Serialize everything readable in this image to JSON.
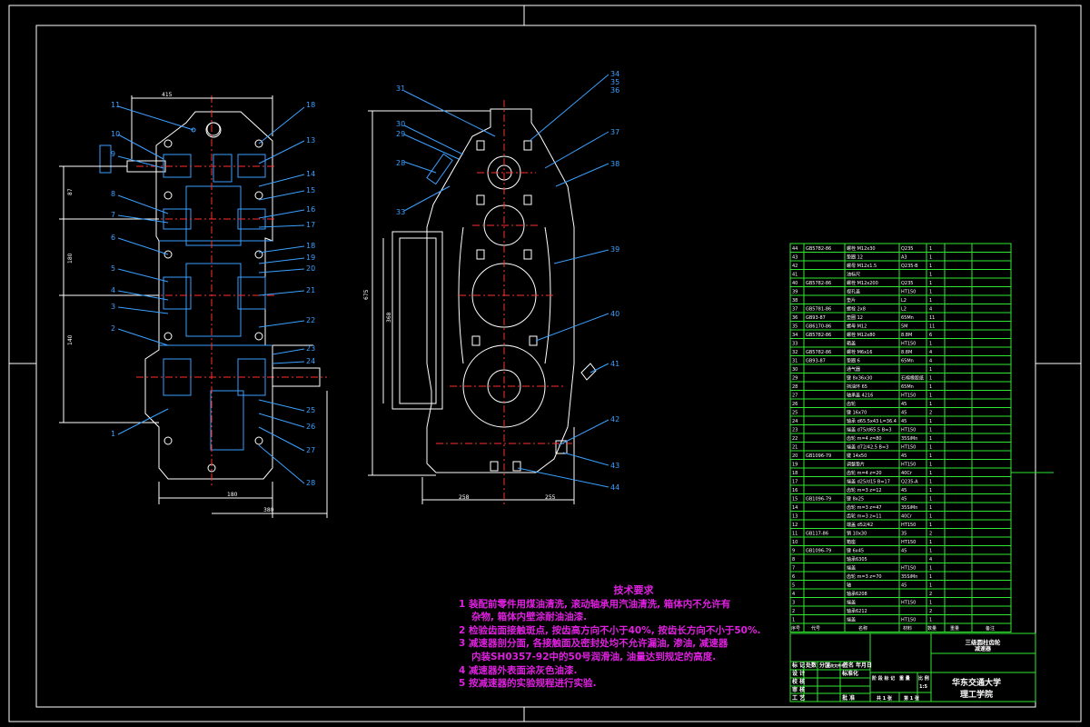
{
  "drawing": {
    "front_view_labels": [
      "11",
      "10",
      "9",
      "8",
      "7",
      "6",
      "5",
      "4",
      "3",
      "2",
      "1",
      "18",
      "13",
      "14",
      "15",
      "16",
      "17",
      "18",
      "19",
      "20",
      "21",
      "22",
      "23",
      "24",
      "25",
      "26",
      "27",
      "28"
    ],
    "side_view_labels": [
      "31",
      "30",
      "29",
      "28",
      "33",
      "34",
      "35",
      "36",
      "37",
      "38",
      "39",
      "40",
      "41",
      "42",
      "43",
      "44"
    ],
    "dims": {
      "top_width": "415",
      "front_bottom_a": "180",
      "front_bottom_b": "380",
      "side_height": "675",
      "side_inner": "368",
      "side_left": "258",
      "side_right": "255",
      "front_left_upper": "87",
      "front_left_mid": "180",
      "front_left_lower": "140"
    }
  },
  "tech_requirements": {
    "title": "技术要求",
    "lines": [
      "1  装配前零件用煤油清洗, 滚动轴承用汽油清洗, 箱体内不允许有",
      "    杂物, 箱体内壁涂耐油油漆.",
      "2  检验齿面接触斑点, 按齿高方向不小于40%, 按齿长方向不小于50%.",
      "3  减速器剖分面, 各接触面及密封处均不允许漏油, 渗油, 减速器",
      "    内装SH0357-92中的50号润滑油, 油量达到规定的高度.",
      "4  减速器外表面涂灰色油漆.",
      "5  按减速器的实验规程进行实验."
    ]
  },
  "parts_list": {
    "rows": [
      {
        "no": "44",
        "std": "GB5782-86",
        "name": "螺栓 M12x30",
        "mat": "Q235",
        "qty": "1"
      },
      {
        "no": "43",
        "std": "",
        "name": "垫圈 12",
        "mat": "A3",
        "qty": "1"
      },
      {
        "no": "42",
        "std": "",
        "name": "螺母 M12x1.5",
        "mat": "Q235-B",
        "qty": "1"
      },
      {
        "no": "41",
        "std": "",
        "name": "油标尺",
        "mat": "",
        "qty": "1"
      },
      {
        "no": "40",
        "std": "GB5782-86",
        "name": "螺栓 M12x200",
        "mat": "Q235",
        "qty": "1"
      },
      {
        "no": "39",
        "std": "",
        "name": "视孔盖",
        "mat": "HT150",
        "qty": "1"
      },
      {
        "no": "38",
        "std": "",
        "name": "垫片",
        "mat": "L2",
        "qty": "1"
      },
      {
        "no": "37",
        "std": "GB5781-86",
        "name": "螺栓 2x8",
        "mat": "L2",
        "qty": "4"
      },
      {
        "no": "36",
        "std": "GB93-87",
        "name": "垫圈 12",
        "mat": "65Mn",
        "qty": "11"
      },
      {
        "no": "35",
        "std": "GB6170-86",
        "name": "螺母 M12",
        "mat": "5M",
        "qty": "11"
      },
      {
        "no": "34",
        "std": "GB5782-86",
        "name": "螺栓 M12x80",
        "mat": "8.8M",
        "qty": "6"
      },
      {
        "no": "33",
        "std": "",
        "name": "箱盖",
        "mat": "HT150",
        "qty": "1"
      },
      {
        "no": "32",
        "std": "GB5782-86",
        "name": "螺栓 M6x16",
        "mat": "8.8M",
        "qty": "4"
      },
      {
        "no": "31",
        "std": "GB93-87",
        "name": "垫圈 6",
        "mat": "65Mn",
        "qty": "4"
      },
      {
        "no": "30",
        "std": "",
        "name": "通气器",
        "mat": "",
        "qty": "1"
      },
      {
        "no": "29",
        "std": "",
        "name": "键 8x36x30",
        "mat": "石棉橡胶纸",
        "qty": "1"
      },
      {
        "no": "28",
        "std": "",
        "name": "挡油环 65",
        "mat": "65Mn",
        "qty": "1"
      },
      {
        "no": "27",
        "std": "",
        "name": "轴承盖 4216",
        "mat": "HT150",
        "qty": "1"
      },
      {
        "no": "26",
        "std": "",
        "name": "齿轮",
        "mat": "45",
        "qty": "1"
      },
      {
        "no": "25",
        "std": "",
        "name": "键 16x70",
        "mat": "45",
        "qty": "2"
      },
      {
        "no": "24",
        "std": "",
        "name": "轴承 d65.5x43 L=36.4",
        "mat": "45",
        "qty": "1"
      },
      {
        "no": "23",
        "std": "",
        "name": "端盖 d75/d65.5 B=3",
        "mat": "HT150",
        "qty": "1"
      },
      {
        "no": "22",
        "std": "",
        "name": "齿轮 m=4 z=80",
        "mat": "35SiMn",
        "qty": "1"
      },
      {
        "no": "21",
        "std": "",
        "name": "端盖 d72/42.5 B=3",
        "mat": "HT150",
        "qty": "1"
      },
      {
        "no": "20",
        "std": "GB1096-79",
        "name": "键 14x50",
        "mat": "45",
        "qty": "1"
      },
      {
        "no": "19",
        "std": "",
        "name": "调整垫片",
        "mat": "HT150",
        "qty": "1"
      },
      {
        "no": "18",
        "std": "",
        "name": "齿轮 m=4 z=20",
        "mat": "40Cr",
        "qty": "1"
      },
      {
        "no": "17",
        "std": "",
        "name": "端盖 d25/d15 B=17",
        "mat": "Q235-A",
        "qty": "1"
      },
      {
        "no": "16",
        "std": "",
        "name": "齿轮 m=3 z=12",
        "mat": "45",
        "qty": "1"
      },
      {
        "no": "15",
        "std": "GB1096-79",
        "name": "键 8x25",
        "mat": "45",
        "qty": "1"
      },
      {
        "no": "14",
        "std": "",
        "name": "齿轮 m=3 z=47",
        "mat": "35SiMn",
        "qty": "1"
      },
      {
        "no": "13",
        "std": "",
        "name": "齿轮 m=3 z=11",
        "mat": "40Cr",
        "qty": "1"
      },
      {
        "no": "12",
        "std": "",
        "name": "端盖 d52/42",
        "mat": "HT150",
        "qty": "1"
      },
      {
        "no": "11",
        "std": "GB117-86",
        "name": "销 10x30",
        "mat": "35",
        "qty": "2"
      },
      {
        "no": "10",
        "std": "",
        "name": "箱座",
        "mat": "HT150",
        "qty": "1"
      },
      {
        "no": "9",
        "std": "GB1096-79",
        "name": "键 6x45",
        "mat": "45",
        "qty": "1"
      },
      {
        "no": "8",
        "std": "",
        "name": "轴承6305",
        "mat": "",
        "qty": "4"
      },
      {
        "no": "7",
        "std": "",
        "name": "端盖",
        "mat": "HT150",
        "qty": "1"
      },
      {
        "no": "6",
        "std": "",
        "name": "齿轮 m=3 z=70",
        "mat": "35SiMn",
        "qty": "1"
      },
      {
        "no": "5",
        "std": "",
        "name": "轴",
        "mat": "45",
        "qty": "1"
      },
      {
        "no": "4",
        "std": "",
        "name": "轴承6208",
        "mat": "",
        "qty": "2"
      },
      {
        "no": "3",
        "std": "",
        "name": "端盖",
        "mat": "HT150",
        "qty": "1"
      },
      {
        "no": "2",
        "std": "",
        "name": "轴承6212",
        "mat": "",
        "qty": "2"
      },
      {
        "no": "1",
        "std": "",
        "name": "端盖",
        "mat": "HT150",
        "qty": "1"
      }
    ],
    "header": {
      "no": "序号",
      "std": "代号",
      "name": "名称",
      "mat": "材料",
      "qty": "数量",
      "weight": "重量",
      "remark": "备注"
    }
  },
  "title_block": {
    "product": "三级圆柱齿轮",
    "product_sub": "减速器",
    "university": "华东交通大学",
    "college": "理工学院",
    "scale": "1:5",
    "sheet": "共 1 张",
    "sheet_no": "第 1 张",
    "row_labels": [
      "标 记",
      "设 计",
      "校 核",
      "审 核",
      "工 艺"
    ],
    "row_extra": [
      "处数",
      "分区",
      "更改文件号",
      "签名",
      "年月日"
    ],
    "stage_labels": [
      "阶 段 标 记",
      "重 量",
      "比 例"
    ],
    "date": "年月日",
    "sign_a": "标准化",
    "sign_b": "批 准"
  }
}
